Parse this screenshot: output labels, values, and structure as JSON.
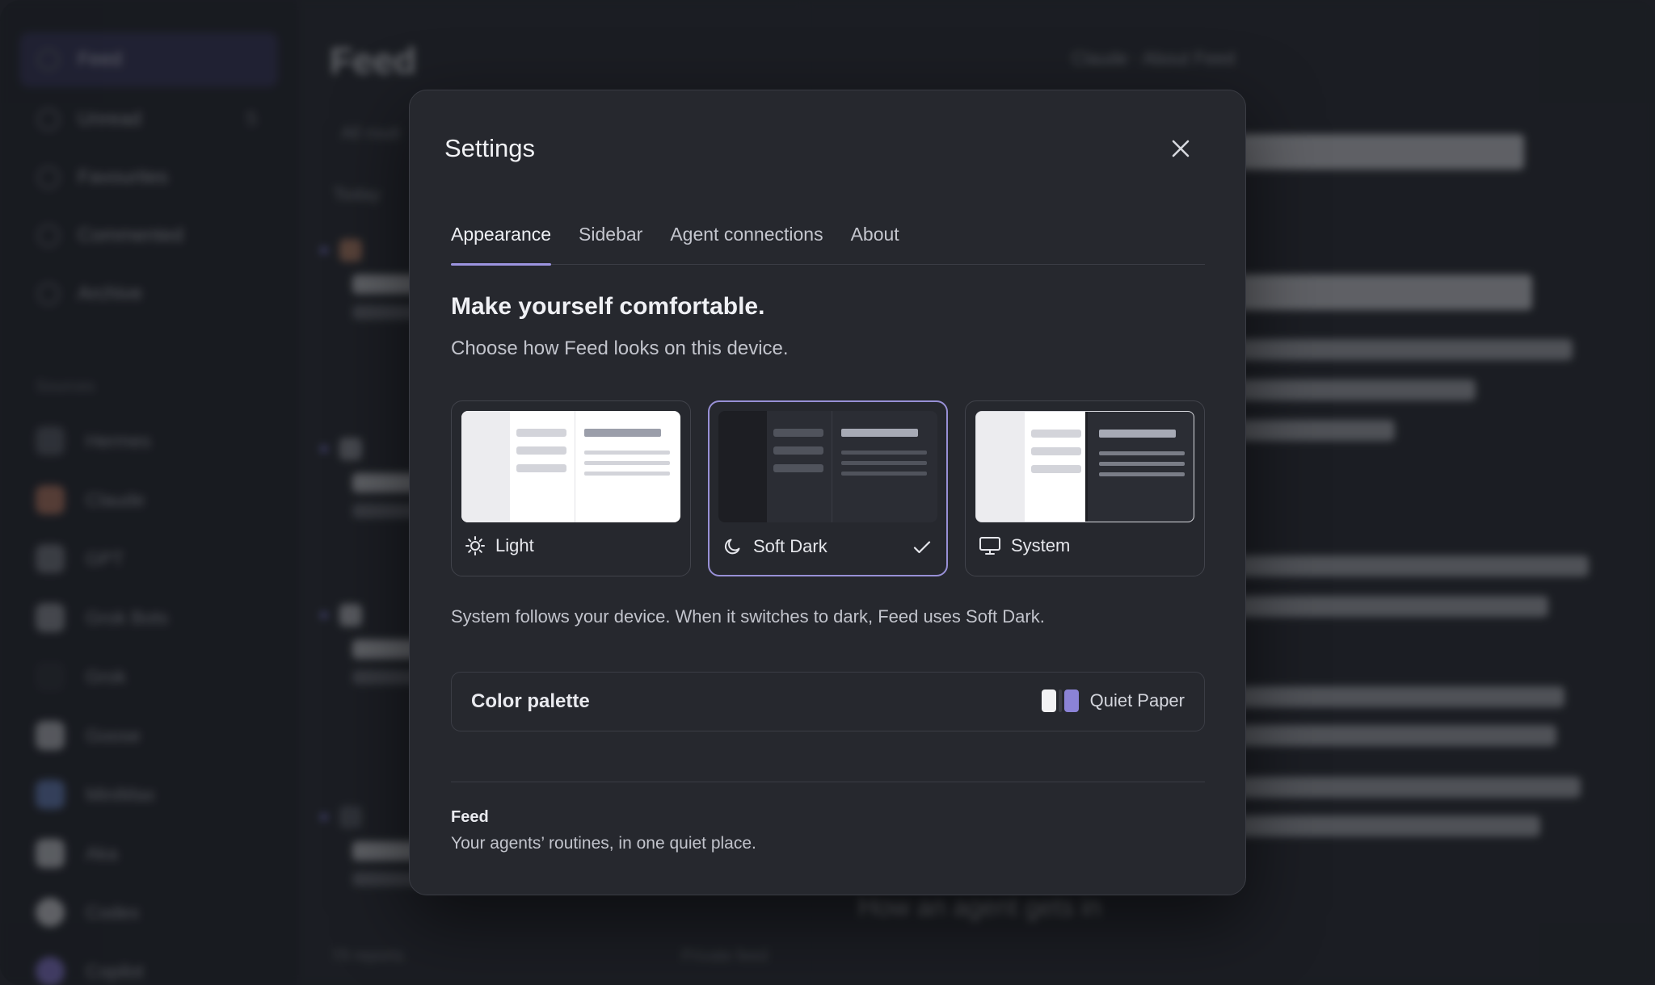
{
  "background": {
    "sidebar": {
      "items": [
        {
          "label": "Feed",
          "active": true
        },
        {
          "label": "Unread",
          "count": "5"
        },
        {
          "label": "Favourites"
        },
        {
          "label": "Commented"
        },
        {
          "label": "Archive"
        }
      ],
      "sources_label": "Sources",
      "sources": [
        "Hermes",
        "Claude",
        "GPT",
        "Grok Bots",
        "Grok",
        "Goose",
        "MiniMax",
        "Aka",
        "Codex",
        "Copilot"
      ]
    },
    "list": {
      "title": "Feed",
      "filter": "All routi",
      "group": "Today",
      "footer_count": "78 reports",
      "footer_right": "Private feed"
    },
    "reader": {
      "breadcrumb": "Claude · About Feed",
      "heading": "How an agent gets in"
    }
  },
  "modal": {
    "title": "Settings",
    "tabs": [
      "Appearance",
      "Sidebar",
      "Agent connections",
      "About"
    ],
    "active_tab": "Appearance",
    "heading": "Make yourself comfortable.",
    "subheading": "Choose how Feed looks on this device.",
    "themes": [
      {
        "label": "Light",
        "icon": "sun-icon"
      },
      {
        "label": "Soft Dark",
        "icon": "moon-icon",
        "selected": true
      },
      {
        "label": "System",
        "icon": "monitor-icon"
      }
    ],
    "system_note": "System follows your device. When it switches to dark, Feed uses Soft Dark.",
    "palette": {
      "label": "Color palette",
      "value": "Quiet Paper",
      "swatch": [
        "#f2f2f4",
        "#8b83d6"
      ]
    },
    "about": {
      "name": "Feed",
      "tagline": "Your agents’ routines, in one quiet place."
    }
  },
  "colors": {
    "accent": "#9c94e0",
    "modal_bg": "#26282e",
    "app_bg": "#23252c"
  }
}
